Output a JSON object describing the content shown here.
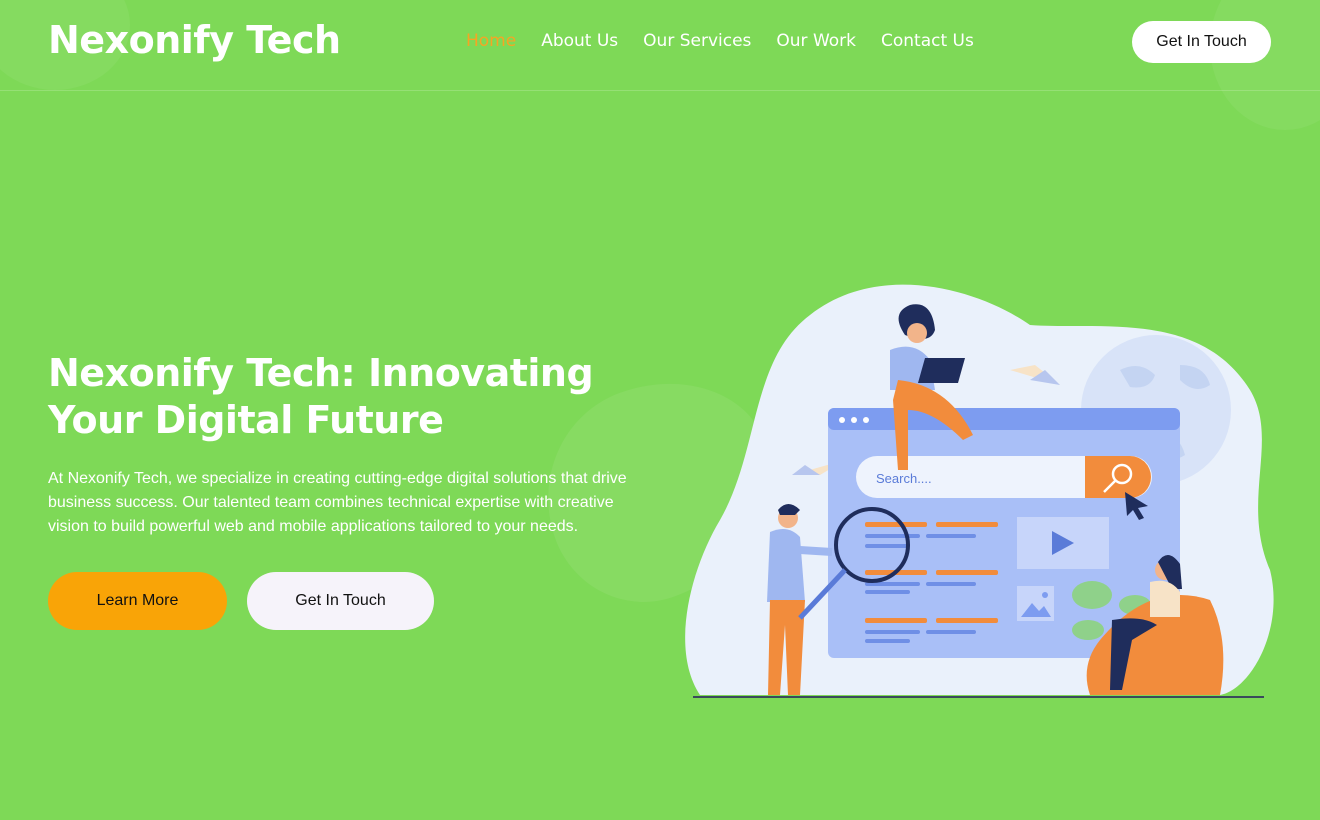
{
  "brand": {
    "name": "Nexonify Tech"
  },
  "nav": {
    "items": [
      {
        "label": "Home",
        "active": true
      },
      {
        "label": "About Us",
        "active": false
      },
      {
        "label": "Our Services",
        "active": false
      },
      {
        "label": "Our Work",
        "active": false
      },
      {
        "label": "Contact Us",
        "active": false
      }
    ]
  },
  "header": {
    "cta_label": "Get In Touch"
  },
  "hero": {
    "title": "Nexonify Tech: Innovating Your Digital Future",
    "description": "At Nexonify Tech, we specialize in creating cutting-edge digital solutions that drive business success. Our talented team combines technical expertise with creative vision to build powerful web and mobile applications tailored to your needs.",
    "primary_button": "Learn More",
    "secondary_button": "Get In Touch"
  },
  "illustration": {
    "search_placeholder": "Search...."
  },
  "colors": {
    "background": "#7ed957",
    "accent": "#f9a407",
    "active_nav": "#f5a524",
    "light_button": "#f6f3fa"
  },
  "icons": [
    "magnifier-icon",
    "play-icon",
    "image-icon",
    "cursor-icon",
    "paper-plane-icon",
    "globe-icon"
  ]
}
